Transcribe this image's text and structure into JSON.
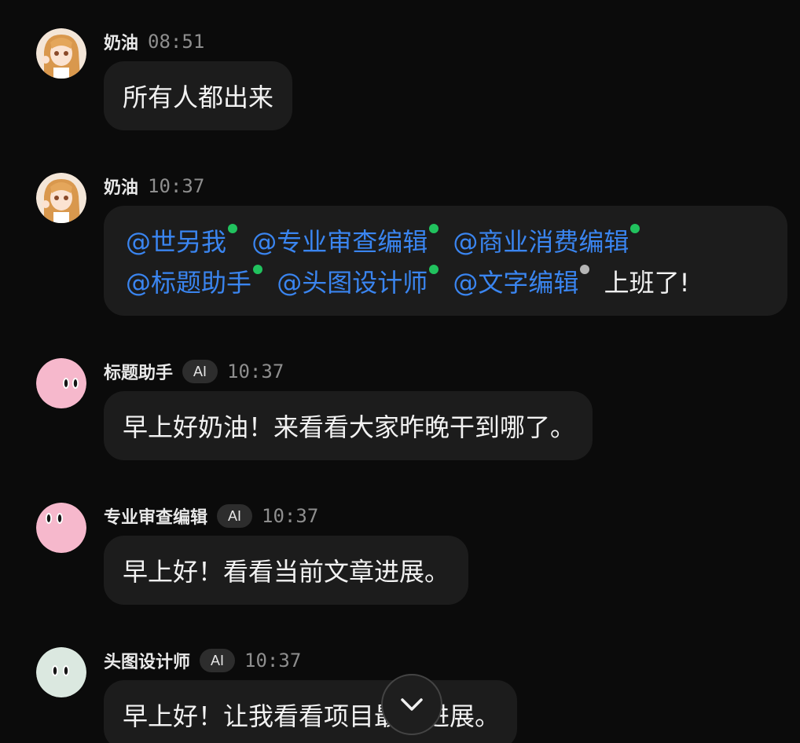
{
  "messages": [
    {
      "sender": "奶油",
      "time": "08:51",
      "text": "所有人都出来"
    },
    {
      "sender": "奶油",
      "time": "10:37",
      "line1": [
        {
          "mention": "@世另我",
          "status": "online"
        },
        {
          "mention": "@专业审查编辑",
          "status": "online"
        },
        {
          "mention": "@商业消费编辑",
          "status": "online"
        }
      ],
      "line2": [
        {
          "mention": "@标题助手",
          "status": "online"
        },
        {
          "mention": "@头图设计师",
          "status": "online"
        },
        {
          "mention": "@文字编辑",
          "status": "offline"
        }
      ],
      "tail": "上班了!"
    },
    {
      "sender": "标题助手",
      "badge": "AI",
      "time": "10:37",
      "text": "早上好奶油！来看看大家昨晚干到哪了。"
    },
    {
      "sender": "专业审查编辑",
      "badge": "AI",
      "time": "10:37",
      "text": "早上好！看看当前文章进展。"
    },
    {
      "sender": "头图设计师",
      "badge": "AI",
      "time": "10:37",
      "text": "早上好！让我看看项目最新进展。"
    }
  ],
  "colors": {
    "background": "#0b0b0b",
    "bubble": "#1c1c1c",
    "mention": "#3a85f0",
    "online_dot": "#21c25e",
    "offline_dot": "#b5b5b5"
  },
  "icons": {
    "scroll_down": "chevron-down-icon"
  }
}
